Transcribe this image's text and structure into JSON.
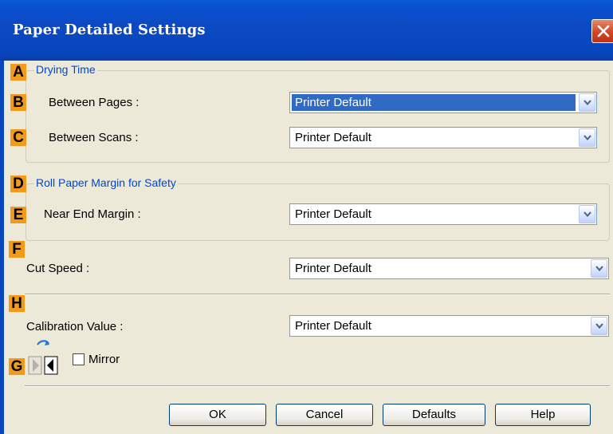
{
  "window": {
    "title": "Paper Detailed Settings"
  },
  "drying_time": {
    "marker": "A",
    "title": "Drying Time",
    "between_pages": {
      "marker": "B",
      "label": "Between Pages :",
      "value": "Printer Default"
    },
    "between_scans": {
      "marker": "C",
      "label": "Between Scans :",
      "value": "Printer Default"
    }
  },
  "roll_paper": {
    "marker": "D",
    "title": "Roll Paper Margin for Safety",
    "near_end": {
      "marker": "E",
      "label": "Near End Margin :",
      "value": "Printer Default"
    }
  },
  "cut_speed": {
    "marker": "F",
    "label": "Cut Speed :",
    "value": "Printer Default"
  },
  "calibration": {
    "marker": "H",
    "label": "Calibration Value :",
    "value": "Printer Default"
  },
  "mirror": {
    "marker": "G",
    "label": "Mirror",
    "checked": false
  },
  "buttons": {
    "ok": "OK",
    "cancel": "Cancel",
    "defaults": "Defaults",
    "help": "Help"
  },
  "colors": {
    "marker": "#f39a1c",
    "titlebar": "#0846bd",
    "group_title": "#0046d5",
    "selection": "#316ac5"
  }
}
